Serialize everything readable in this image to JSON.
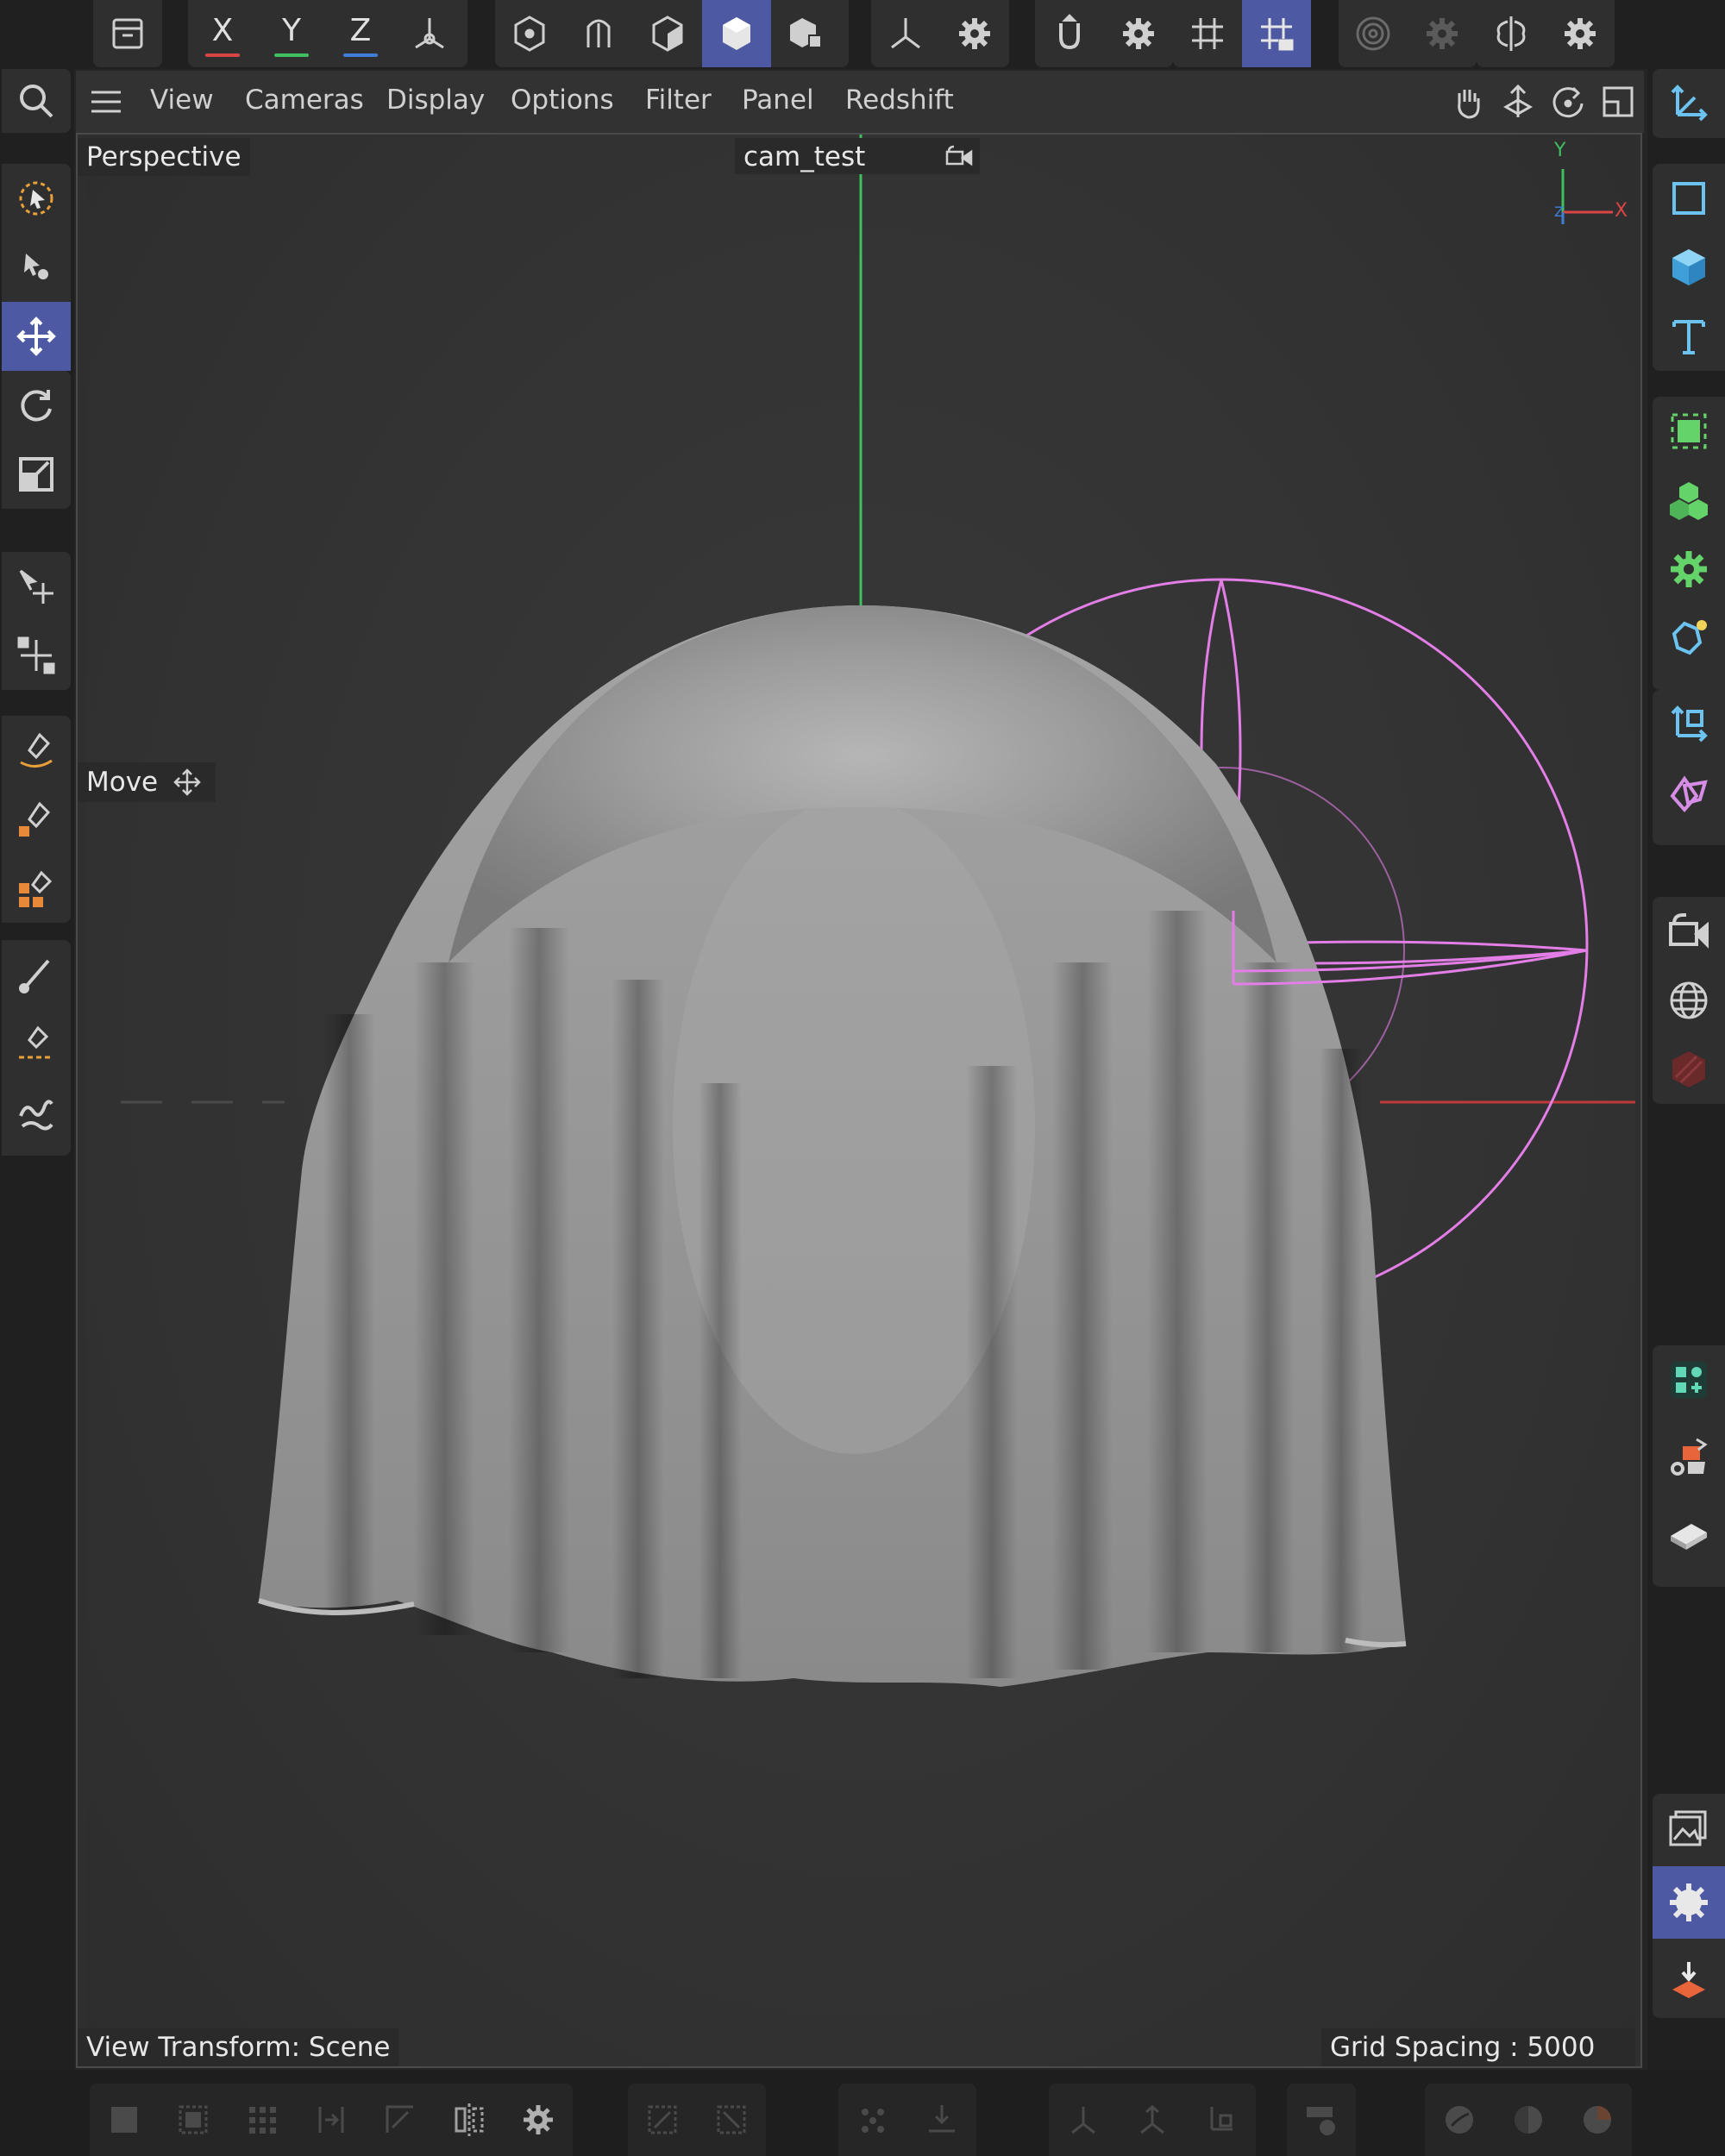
{
  "menubar": {
    "items": [
      "View",
      "Cameras",
      "Display",
      "Options",
      "Filter",
      "Panel",
      "Redshift"
    ]
  },
  "axes": {
    "x": "X",
    "y": "Y",
    "z": "Z"
  },
  "viewport": {
    "view_name": "Perspective",
    "camera_name": "cam_test",
    "active_tool": "Move",
    "view_transform": "View Transform: Scene",
    "grid_spacing": "Grid Spacing : 5000 cm",
    "orientation_axes": {
      "y": "Y",
      "x": "X",
      "z": "Z"
    }
  },
  "colors": {
    "accent_active": "#4d5aa3",
    "x_axis": "#d94545",
    "y_axis": "#3fbf5f",
    "z_axis": "#3f7fd9",
    "light_gizmo": "#e27ee6",
    "object_tool": "#6cc3ef",
    "generator_tool": "#63d36a",
    "orange_accent": "#e8893a"
  },
  "icons": {
    "top": [
      "undo-icon",
      "x-axis-lock",
      "y-axis-lock",
      "z-axis-lock",
      "coordinate-system-icon",
      "points-mode-icon",
      "edges-mode-icon",
      "polygons-mode-icon",
      "model-mode-icon",
      "texture-mode-icon",
      "axis-mode-icon",
      "axis-settings-gear-icon",
      "snap-magnet-icon",
      "snap-settings-gear-icon",
      "grid-icon",
      "workplane-lock-icon",
      "soft-selection-icon",
      "soft-selection-gear-icon",
      "symmetry-icon",
      "symmetry-gear-icon"
    ],
    "left": [
      "search-icon",
      "live-selection-icon",
      "selection-tools-icon",
      "move-icon",
      "rotate-icon",
      "scale-icon",
      "transform-icon",
      "placement-icon",
      "spline-pen-icon",
      "spline-sketch-icon",
      "spline-tools-icon",
      "paint-brush-icon",
      "knife-icon",
      "smoothing-icon"
    ],
    "right": [
      "coordinate-manager-icon",
      "spline-primitive-icon",
      "cube-primitive-icon",
      "text-icon",
      "generators-icon",
      "cloner-icon",
      "deformers-icon",
      "fields-icon",
      "null-icon",
      "scene-icon",
      "camera-icon",
      "environment-icon",
      "redshift-icon",
      "polygon-pen-icon",
      "material-tag-icon",
      "floor-icon",
      "picture-viewer-icon",
      "render-settings-icon",
      "render-queue-icon"
    ],
    "bottom": [
      "render-region-icon",
      "render-view-icon",
      "render-icon",
      "render-active-icon",
      "render-queue-frame-icon",
      "snapshot-icon",
      "bottom-settings-gear-icon",
      "uv-edit-icon",
      "uv-transform-icon",
      "point-mode-icon",
      "paint-mode-icon",
      "spline-add-icon",
      "spline-insert-icon",
      "spline-point-icon",
      "material-manager-icon",
      "shader-ball-icon",
      "shader-ball-dark-icon",
      "shader-ball-orange-icon"
    ]
  }
}
